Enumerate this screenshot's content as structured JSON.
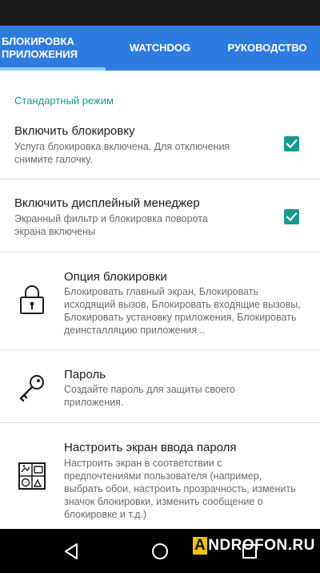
{
  "tabs": [
    {
      "label": "БЛОКИРОВКА\nПРИЛОЖЕНИЯ",
      "selected": true
    },
    {
      "label": "WATCHDOG",
      "selected": false
    },
    {
      "label": "РУКОВОДСТВО",
      "selected": false
    }
  ],
  "section_header": "Стандартный режим",
  "prefs": [
    {
      "title": "Включить блокировку",
      "summary": "Услуга блокировка включена. Для отключения снимите галочку.",
      "checked": true
    },
    {
      "title": "Включить дисплейный менеджер",
      "summary": "Экранный фильтр и блокировка поворота экрана включены",
      "checked": true
    }
  ],
  "options": [
    {
      "icon": "lock-icon",
      "title": "Опция блокировки",
      "summary": "Блокировать главный экран, Блокировать исходящий вызов, Блокировать входящие вызовы, Блокировать установку приложения, Блокировать деинсталляцию приложения .."
    },
    {
      "icon": "key-icon",
      "title": "Пароль",
      "summary": "Создайте пароль для защиты своего приложения."
    },
    {
      "icon": "screen-layout-icon",
      "title": "Настроить экран ввода пароля",
      "summary": "Настроить экран в соответствии с предпочтениями пользователя (например, выбрать обои, настроить прозрачность, изменить значок блокировки, изменить сообщение о блокировке и т.д.)"
    }
  ],
  "nav": {
    "back": "back-icon",
    "home": "home-icon",
    "recent": "recent-apps-icon"
  },
  "watermark": {
    "first": "A",
    "rest": "NDROFON.RU"
  },
  "colors": {
    "tab_bar": "#2f7ce0",
    "accent": "#1b9a8c",
    "indicator": "#8ccaff"
  }
}
